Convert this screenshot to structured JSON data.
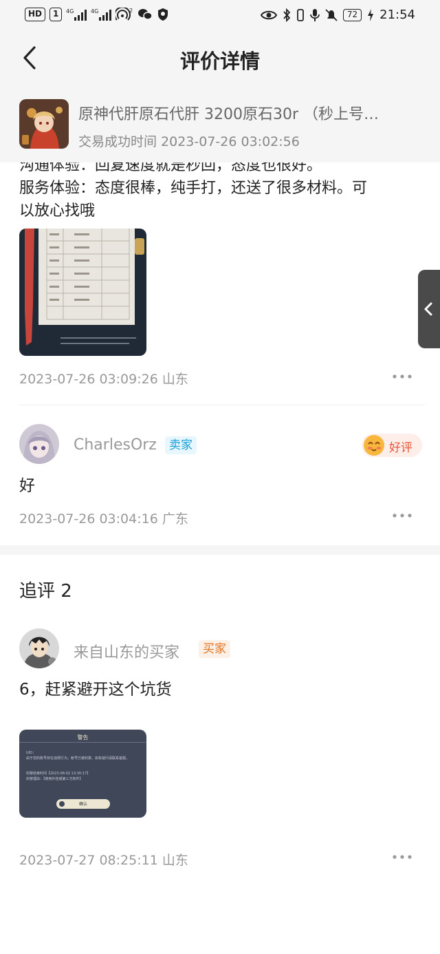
{
  "status_bar": {
    "left_badges": [
      "HD",
      "1"
    ],
    "signal_labels": [
      "4G",
      "4G",
      "2"
    ],
    "battery": "72",
    "time": "21:54"
  },
  "header": {
    "title": "评价详情",
    "back_icon": "chevron-left-icon"
  },
  "product": {
    "name": "原神代肝原石代肝 3200原石30r （秒上号…",
    "time": "交易成功时间 2023-07-26 03:02:56"
  },
  "review": {
    "line_partial": "沟通体验：回复速度就是秒回，态度也很好。",
    "line_service": "服务体验：态度很棒，纯手打，还送了很多材料。可",
    "line_service_cont": "以放心找哦",
    "meta": "2023-07-26 03:09:26  山东"
  },
  "seller_reply": {
    "username": "CharlesOrz",
    "role": "卖家",
    "rating": "好评",
    "text": "好",
    "meta": "2023-07-26 03:04:16  广东"
  },
  "follow_up": {
    "title": "追评 2",
    "username": "来自山东的买家",
    "role": "买家",
    "text": "6，赶紧避开这个坑货",
    "screenshot": {
      "title": "警告",
      "uid_label": "UID：",
      "body": "由于您的账号存在违规行为，帐号已被封禁，如有疑问请联系客服。",
      "ban_time": "封禁结束时间【2023-08-02 13:30:17】",
      "ban_reason": "封禁理由：【使用外挂或第三方软件】",
      "confirm": "确认"
    },
    "meta": "2023-07-27 08:25:11  山东"
  },
  "colors": {
    "background": "#f5f5f5",
    "seller_tag": "#1aa0d8",
    "buyer_tag": "#e0731f",
    "good_rating": "#e8553a"
  }
}
